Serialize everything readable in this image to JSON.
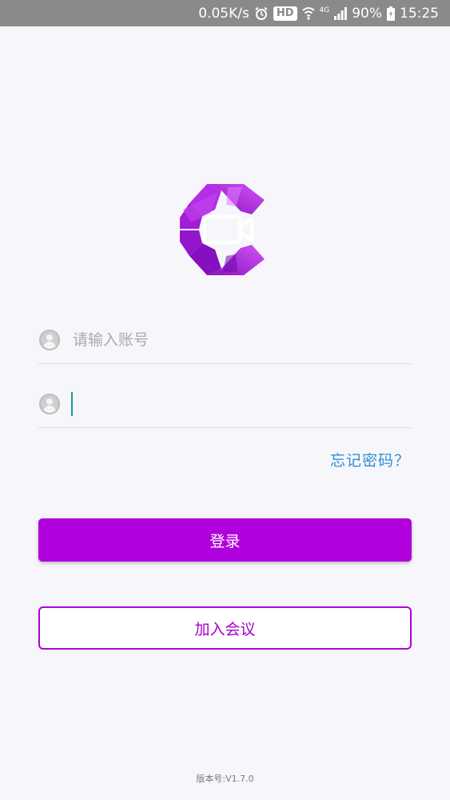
{
  "status_bar": {
    "speed": "0.05K/s",
    "hd": "HD",
    "network_type": "4G",
    "battery": "90%",
    "time": "15:25"
  },
  "login": {
    "account_placeholder": "请输入账号",
    "password_value": "",
    "forgot_password": "忘记密码？",
    "login_button": "登录",
    "join_meeting_button": "加入会议"
  },
  "footer": {
    "version": "版本号:V1.7.0"
  },
  "colors": {
    "brand": "#b000dc",
    "link": "#2f8fd6",
    "cursor": "#1a9b8f"
  },
  "icons": {
    "logo": "app-logo-octagon-camera",
    "account": "user-avatar-icon",
    "password": "user-avatar-icon"
  }
}
